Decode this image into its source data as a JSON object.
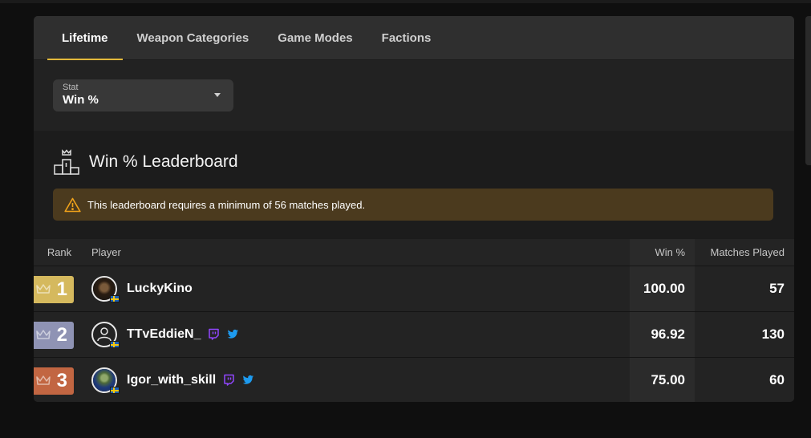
{
  "tabs": [
    {
      "label": "Lifetime",
      "active": true
    },
    {
      "label": "Weapon Categories",
      "active": false
    },
    {
      "label": "Game Modes",
      "active": false
    },
    {
      "label": "Factions",
      "active": false
    }
  ],
  "stat_select": {
    "label": "Stat",
    "value": "Win %",
    "icon": "chevron-down-icon"
  },
  "leaderboard": {
    "title": "Win % Leaderboard",
    "icon": "podium-icon",
    "notice": {
      "icon": "warning-icon",
      "text": "This leaderboard requires a minimum of 56 matches played."
    },
    "columns": {
      "rank": "Rank",
      "player": "Player",
      "win": "Win %",
      "matches": "Matches Played"
    },
    "rows": [
      {
        "rank": "1",
        "tier": "gold",
        "player": "LuckyKino",
        "win": "100.00",
        "matches": "57",
        "twitch": false,
        "twitter": false,
        "country": "Sweden"
      },
      {
        "rank": "2",
        "tier": "silver",
        "player": "TTvEddieN_",
        "win": "96.92",
        "matches": "130",
        "twitch": true,
        "twitter": true,
        "country": "Sweden"
      },
      {
        "rank": "3",
        "tier": "bronze",
        "player": "Igor_with_skill",
        "win": "75.00",
        "matches": "60",
        "twitch": true,
        "twitter": true,
        "country": "Sweden"
      }
    ]
  },
  "colors": {
    "accent": "#e2b93b",
    "gold": "#d5b95e",
    "silver": "#8f93b4",
    "bronze": "#c26642",
    "twitch": "#9146ff",
    "twitter": "#1d9bf0",
    "notice_bg": "#4b3a1e"
  }
}
